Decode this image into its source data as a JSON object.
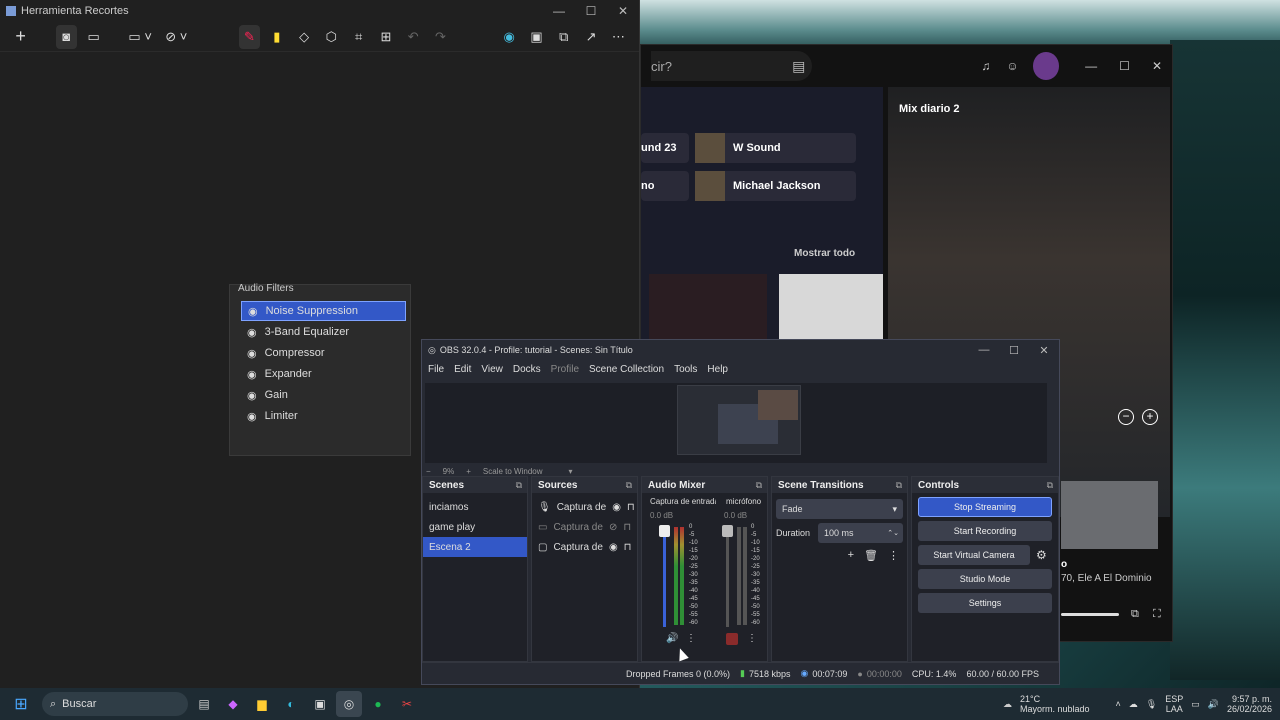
{
  "snipping": {
    "title": "Herramienta Recortes"
  },
  "spotify": {
    "search_text": "cir?",
    "mix_title": "Mix diario 2",
    "cards": [
      {
        "label": "und 23"
      },
      {
        "label": "W Sound"
      },
      {
        "label": "no"
      },
      {
        "label": "Michael Jackson"
      }
    ],
    "show_all": "Mostrar todo",
    "track_line": "o",
    "track_artists": "70, Ele A El Dominio"
  },
  "filters": {
    "title": "Audio Filters",
    "items": [
      {
        "label": "Noise Suppression"
      },
      {
        "label": "3-Band Equalizer"
      },
      {
        "label": "Compressor"
      },
      {
        "label": "Expander"
      },
      {
        "label": "Gain"
      },
      {
        "label": "Limiter"
      }
    ]
  },
  "obs": {
    "title": "OBS 32.0.4 - Profile: tutorial - Scenes: Sin Título",
    "menu": [
      "File",
      "Edit",
      "View",
      "Docks",
      "Profile",
      "Scene Collection",
      "Tools",
      "Help"
    ],
    "zoom": {
      "minus": "−",
      "percent": "9%",
      "plus": "+",
      "scale": "Scale to Window"
    },
    "scenes_title": "Scenes",
    "scenes": [
      "inciamos",
      "game play",
      "Escena 2"
    ],
    "sources_title": "Sources",
    "sources": [
      "Captura de",
      "Captura de",
      "Captura de"
    ],
    "mixer_title": "Audio Mixer",
    "channels": [
      {
        "name": "Captura de entrada",
        "db": "0.0 dB"
      },
      {
        "name": "micrófono",
        "db": "0.0 dB"
      }
    ],
    "meter_ticks": [
      "0",
      "-5",
      "-10",
      "-15",
      "-20",
      "-25",
      "-30",
      "-35",
      "-40",
      "-45",
      "-50",
      "-55",
      "-60"
    ],
    "transitions_title": "Scene Transitions",
    "transition": "Fade",
    "duration_label": "Duration",
    "duration_value": "100 ms",
    "controls_title": "Controls",
    "controls": {
      "stop_streaming": "Stop Streaming",
      "start_recording": "Start Recording",
      "start_virtual_camera": "Start Virtual Camera",
      "studio_mode": "Studio Mode",
      "settings": "Settings"
    },
    "status": {
      "dropped": "Dropped Frames 0 (0.0%)",
      "bitrate": "7518 kbps",
      "stream_time": "00:07:09",
      "rec_time": "00:00:00",
      "cpu": "CPU: 1.4%",
      "fps": "60.00 / 60.00 FPS"
    }
  },
  "taskbar": {
    "search": "Buscar",
    "weather_temp": "21°C",
    "weather_desc": "Mayorm. nublado",
    "lang1": "ESP",
    "lang2": "LAA",
    "time": "9:57 p. m.",
    "date": "26/02/2026"
  },
  "colors": {
    "accent": "#3358c7",
    "panel": "#1f2128",
    "obs_bg": "#272a33"
  }
}
